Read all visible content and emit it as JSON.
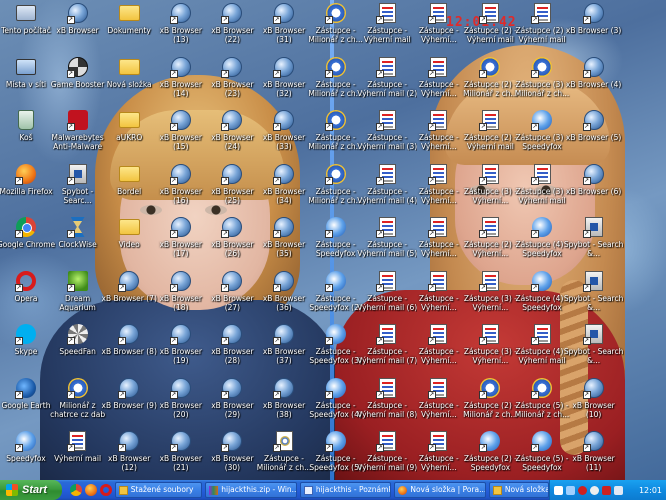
{
  "overlay_clock": "12:01:42",
  "taskbar": {
    "start_label": "Start",
    "tasks": [
      {
        "label": "Stažené soubory",
        "icon": "folder-icon"
      },
      {
        "label": "hijackthis.zip - Win...",
        "icon": "winrar-icon"
      },
      {
        "label": "hijackthis - Poznámk...",
        "icon": "notepad-icon"
      },
      {
        "label": "Nová složka | Pora...",
        "icon": "firefox-icon"
      },
      {
        "label": "Nová složka",
        "icon": "folder-icon"
      }
    ],
    "clock": "12:01"
  },
  "icons": [
    {
      "label": "Tento počítač",
      "icon": "computer"
    },
    {
      "label": "Místa v síti",
      "icon": "network"
    },
    {
      "label": "Koš",
      "icon": "recycle-bin"
    },
    {
      "label": "Mozilla Firefox",
      "icon": "firefox"
    },
    {
      "label": "Google Chrome",
      "icon": "chrome"
    },
    {
      "label": "Opera",
      "icon": "opera"
    },
    {
      "label": "Skype",
      "icon": "skype"
    },
    {
      "label": "Google Earth",
      "icon": "google-earth"
    },
    {
      "label": "Speedyfox",
      "icon": "speedyfox"
    },
    {
      "label": "xB Browser",
      "icon": "xb-browser"
    },
    {
      "label": "Game Booster",
      "icon": "game-booster"
    },
    {
      "label": "Malwarebytes Anti-Malware",
      "icon": "malwarebytes"
    },
    {
      "label": "Spybot - Searc...",
      "icon": "spybot"
    },
    {
      "label": "ClockWise",
      "icon": "hourglass"
    },
    {
      "label": "Dream Aquarium",
      "icon": "aquarium"
    },
    {
      "label": "SpeedFan",
      "icon": "speedfan"
    },
    {
      "label": "Milionář z chatrce cz dab",
      "icon": "milionar"
    },
    {
      "label": "Výherní mail",
      "icon": "vyherni-mail"
    },
    {
      "label": "Dokumenty",
      "icon": "folder"
    },
    {
      "label": "Nová složka",
      "icon": "folder"
    },
    {
      "label": "aUKRO",
      "icon": "folder"
    },
    {
      "label": "Bordel",
      "icon": "folder"
    },
    {
      "label": "Video",
      "icon": "folder"
    },
    {
      "label": "xB Browser (7)",
      "icon": "xb-browser"
    },
    {
      "label": "xB Browser (8)",
      "icon": "xb-browser"
    },
    {
      "label": "xB Browser (9)",
      "icon": "xb-browser"
    },
    {
      "label": "xB Browser (12)",
      "icon": "xb-browser"
    },
    {
      "label": "xB Browser (13)",
      "icon": "xb-browser"
    },
    {
      "label": "xB Browser (14)",
      "icon": "xb-browser"
    },
    {
      "label": "xB Browser (15)",
      "icon": "xb-browser"
    },
    {
      "label": "xB Browser (16)",
      "icon": "xb-browser"
    },
    {
      "label": "xB Browser (17)",
      "icon": "xb-browser"
    },
    {
      "label": "xB Browser (18)",
      "icon": "xb-browser"
    },
    {
      "label": "xB Browser (19)",
      "icon": "xb-browser"
    },
    {
      "label": "xB Browser (20)",
      "icon": "xb-browser"
    },
    {
      "label": "xB Browser (21)",
      "icon": "xb-browser"
    },
    {
      "label": "xB Browser (22)",
      "icon": "xb-browser"
    },
    {
      "label": "xB Browser (23)",
      "icon": "xb-browser"
    },
    {
      "label": "xB Browser (24)",
      "icon": "xb-browser"
    },
    {
      "label": "xB Browser (25)",
      "icon": "xb-browser"
    },
    {
      "label": "xB Browser (26)",
      "icon": "xb-browser"
    },
    {
      "label": "xB Browser (27)",
      "icon": "xb-browser"
    },
    {
      "label": "xB Browser (28)",
      "icon": "xb-browser"
    },
    {
      "label": "xB Browser (29)",
      "icon": "xb-browser"
    },
    {
      "label": "xB Browser (30)",
      "icon": "xb-browser"
    },
    {
      "label": "xB Browser (31)",
      "icon": "xb-browser"
    },
    {
      "label": "xB Browser (32)",
      "icon": "xb-browser"
    },
    {
      "label": "xB Browser (33)",
      "icon": "xb-browser"
    },
    {
      "label": "xB Browser (34)",
      "icon": "xb-browser"
    },
    {
      "label": "xB Browser (35)",
      "icon": "xb-browser"
    },
    {
      "label": "xB Browser (36)",
      "icon": "xb-browser"
    },
    {
      "label": "xB Browser (37)",
      "icon": "xb-browser"
    },
    {
      "label": "xB Browser (38)",
      "icon": "xb-browser"
    },
    {
      "label": "Zástupce - Milionář z ch...",
      "icon": "milionar-doc"
    },
    {
      "label": "Zástupce - Milionář z ch...",
      "icon": "milionar"
    },
    {
      "label": "Zástupce - Milionář z ch...",
      "icon": "milionar"
    },
    {
      "label": "Zástupce - Milionář z ch...",
      "icon": "milionar"
    },
    {
      "label": "Zástupce - Milionář z ch...",
      "icon": "milionar"
    },
    {
      "label": "Zástupce - Speedyfox",
      "icon": "speedyfox"
    },
    {
      "label": "Zástupce - Speedyfox (2)",
      "icon": "speedyfox"
    },
    {
      "label": "Zástupce - Speedyfox (3)",
      "icon": "speedyfox"
    },
    {
      "label": "Zástupce - Speedyfox (4)",
      "icon": "speedyfox"
    },
    {
      "label": "Zástupce - Speedyfox (5)",
      "icon": "speedyfox"
    },
    {
      "label": "Zástupce - Výherní mail",
      "icon": "vyherni-mail"
    },
    {
      "label": "Zástupce - Výherní mail (2)",
      "icon": "vyherni-mail"
    },
    {
      "label": "Zástupce - Výherní mail (3)",
      "icon": "vyherni-mail"
    },
    {
      "label": "Zástupce - Výherní mail (4)",
      "icon": "vyherni-mail"
    },
    {
      "label": "Zástupce - Výherní mail (5)",
      "icon": "vyherni-mail"
    },
    {
      "label": "Zástupce - Výherní mail (6)",
      "icon": "vyherni-mail"
    },
    {
      "label": "Zástupce - Výherní mail (7)",
      "icon": "vyherni-mail"
    },
    {
      "label": "Zástupce - Výherní mail (8)",
      "icon": "vyherni-mail"
    },
    {
      "label": "Zástupce - Výherní mail (9)",
      "icon": "vyherni-mail"
    },
    {
      "label": "Zástupce - Výherní...",
      "icon": "vyherni-mail"
    },
    {
      "label": "Zástupce - Výherní...",
      "icon": "vyherni-mail"
    },
    {
      "label": "Zástupce - Výherní...",
      "icon": "vyherni-mail"
    },
    {
      "label": "Zástupce - Výherní...",
      "icon": "vyherni-mail"
    },
    {
      "label": "Zástupce - Výherní...",
      "icon": "vyherni-mail"
    },
    {
      "label": "Zástupce - Výherní...",
      "icon": "vyherni-mail"
    },
    {
      "label": "Zástupce - Výherní...",
      "icon": "vyherni-mail"
    },
    {
      "label": "Zástupce - Výherní...",
      "icon": "vyherni-mail"
    },
    {
      "label": "Zástupce - Výherní...",
      "icon": "vyherni-mail"
    },
    {
      "label": "Zástupce (2) - Výherní mail",
      "icon": "vyherni-mail"
    },
    {
      "label": "Zástupce (2) - Milionář z ch...",
      "icon": "milionar"
    },
    {
      "label": "Zástupce (2) - Výherní mail",
      "icon": "vyherni-mail"
    },
    {
      "label": "Zástupce (3) - Výherní...",
      "icon": "vyherni-mail"
    },
    {
      "label": "Zástupce (2) - Výherní...",
      "icon": "vyherni-mail"
    },
    {
      "label": "Zástupce (3) - Výherní...",
      "icon": "vyherni-mail"
    },
    {
      "label": "Zástupce (3) - Výherní...",
      "icon": "vyherni-mail"
    },
    {
      "label": "Zástupce (2) - Milionář z ch...",
      "icon": "milionar"
    },
    {
      "label": "Zástupce (2) - Speedyfox",
      "icon": "speedyfox"
    },
    {
      "label": "Zástupce (2) - Výherní mail",
      "icon": "vyherni-mail"
    },
    {
      "label": "Zástupce (3) - Milionář z ch...",
      "icon": "milionar"
    },
    {
      "label": "Zástupce (3) - Speedyfox",
      "icon": "speedyfox"
    },
    {
      "label": "Zástupce (3) - Výherní mail",
      "icon": "vyherni-mail"
    },
    {
      "label": "Zástupce (4) - Speedyfox",
      "icon": "speedyfox"
    },
    {
      "label": "Zástupce (4) - Speedyfox",
      "icon": "speedyfox"
    },
    {
      "label": "Zástupce (4) - Výherní mail",
      "icon": "vyherni-mail"
    },
    {
      "label": "Zástupce (5) - Milionář z ch...",
      "icon": "milionar"
    },
    {
      "label": "Zástupce (5) - Speedyfox",
      "icon": "speedyfox"
    },
    {
      "label": "xB Browser (3)",
      "icon": "xb-browser"
    },
    {
      "label": "xB Browser (4)",
      "icon": "xb-browser"
    },
    {
      "label": "xB Browser (5)",
      "icon": "xb-browser"
    },
    {
      "label": "xB Browser (6)",
      "icon": "xb-browser"
    },
    {
      "label": "Spybot - Search &...",
      "icon": "spybot"
    },
    {
      "label": "Spybot - Search &...",
      "icon": "spybot"
    },
    {
      "label": "Spybot - Search &...",
      "icon": "spybot"
    },
    {
      "label": "xB Browser (10)",
      "icon": "xb-browser"
    },
    {
      "label": "xB Browser (11)",
      "icon": "xb-browser"
    }
  ]
}
